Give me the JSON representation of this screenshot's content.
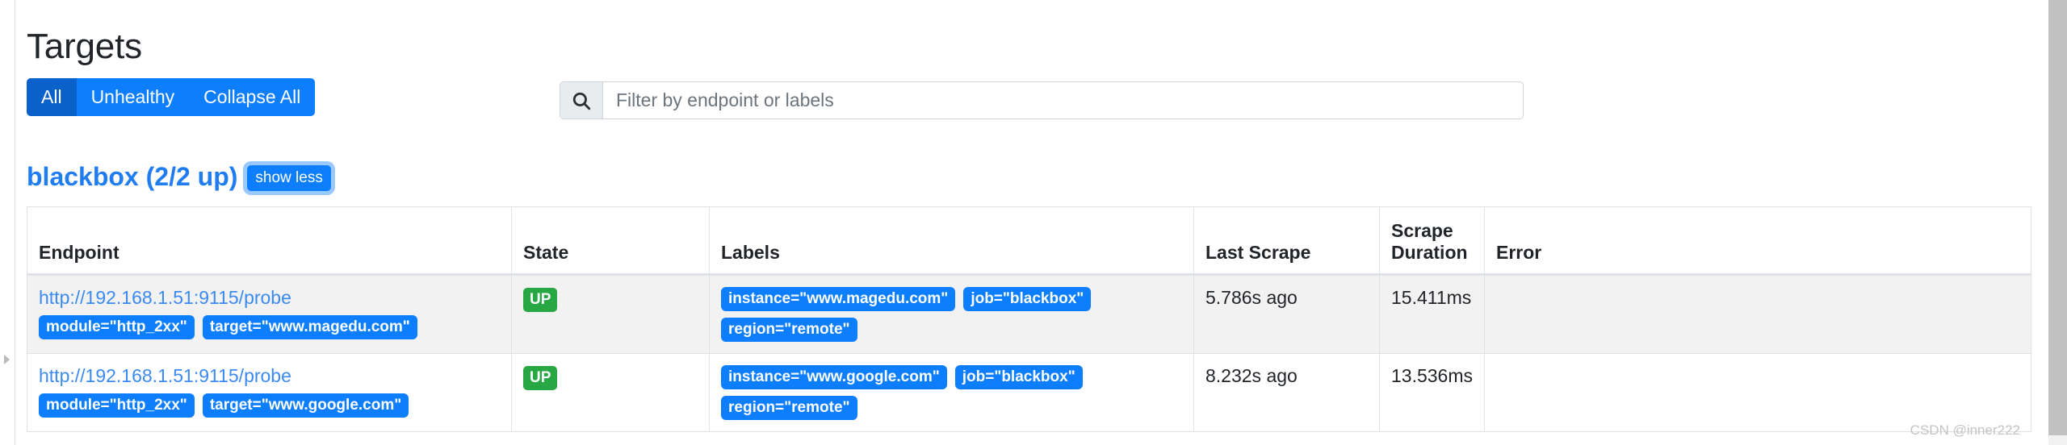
{
  "page": {
    "title": "Targets",
    "watermark": "CSDN @inner222"
  },
  "toolbar": {
    "buttons": [
      {
        "label": "All",
        "active": true
      },
      {
        "label": "Unhealthy",
        "active": false
      },
      {
        "label": "Collapse All",
        "active": false
      }
    ],
    "search": {
      "icon": "search-icon",
      "value": "",
      "placeholder": "Filter by endpoint or labels"
    }
  },
  "job": {
    "heading": "blackbox (2/2 up)",
    "toggle_label": "show less"
  },
  "table": {
    "columns": [
      "Endpoint",
      "State",
      "Labels",
      "Last Scrape",
      "Scrape Duration",
      "Error"
    ],
    "rows": [
      {
        "endpoint": "http://192.168.1.51:9115/probe",
        "endpoint_badges": [
          "module=\"http_2xx\"",
          "target=\"www.magedu.com\""
        ],
        "state": "UP",
        "labels": [
          "instance=\"www.magedu.com\"",
          "job=\"blackbox\"",
          "region=\"remote\""
        ],
        "last_scrape": "5.786s ago",
        "scrape_duration": "15.411ms",
        "error": ""
      },
      {
        "endpoint": "http://192.168.1.51:9115/probe",
        "endpoint_badges": [
          "module=\"http_2xx\"",
          "target=\"www.google.com\""
        ],
        "state": "UP",
        "labels": [
          "instance=\"www.google.com\"",
          "job=\"blackbox\"",
          "region=\"remote\""
        ],
        "last_scrape": "8.232s ago",
        "scrape_duration": "13.536ms",
        "error": ""
      }
    ]
  },
  "colors": {
    "primary": "#0d7efd",
    "primary_active": "#0a61c9",
    "link": "#3b8af2",
    "up_badge": "#28a745",
    "heading_blue": "#1f7cf2",
    "row_stripe": "#f2f2f2"
  }
}
